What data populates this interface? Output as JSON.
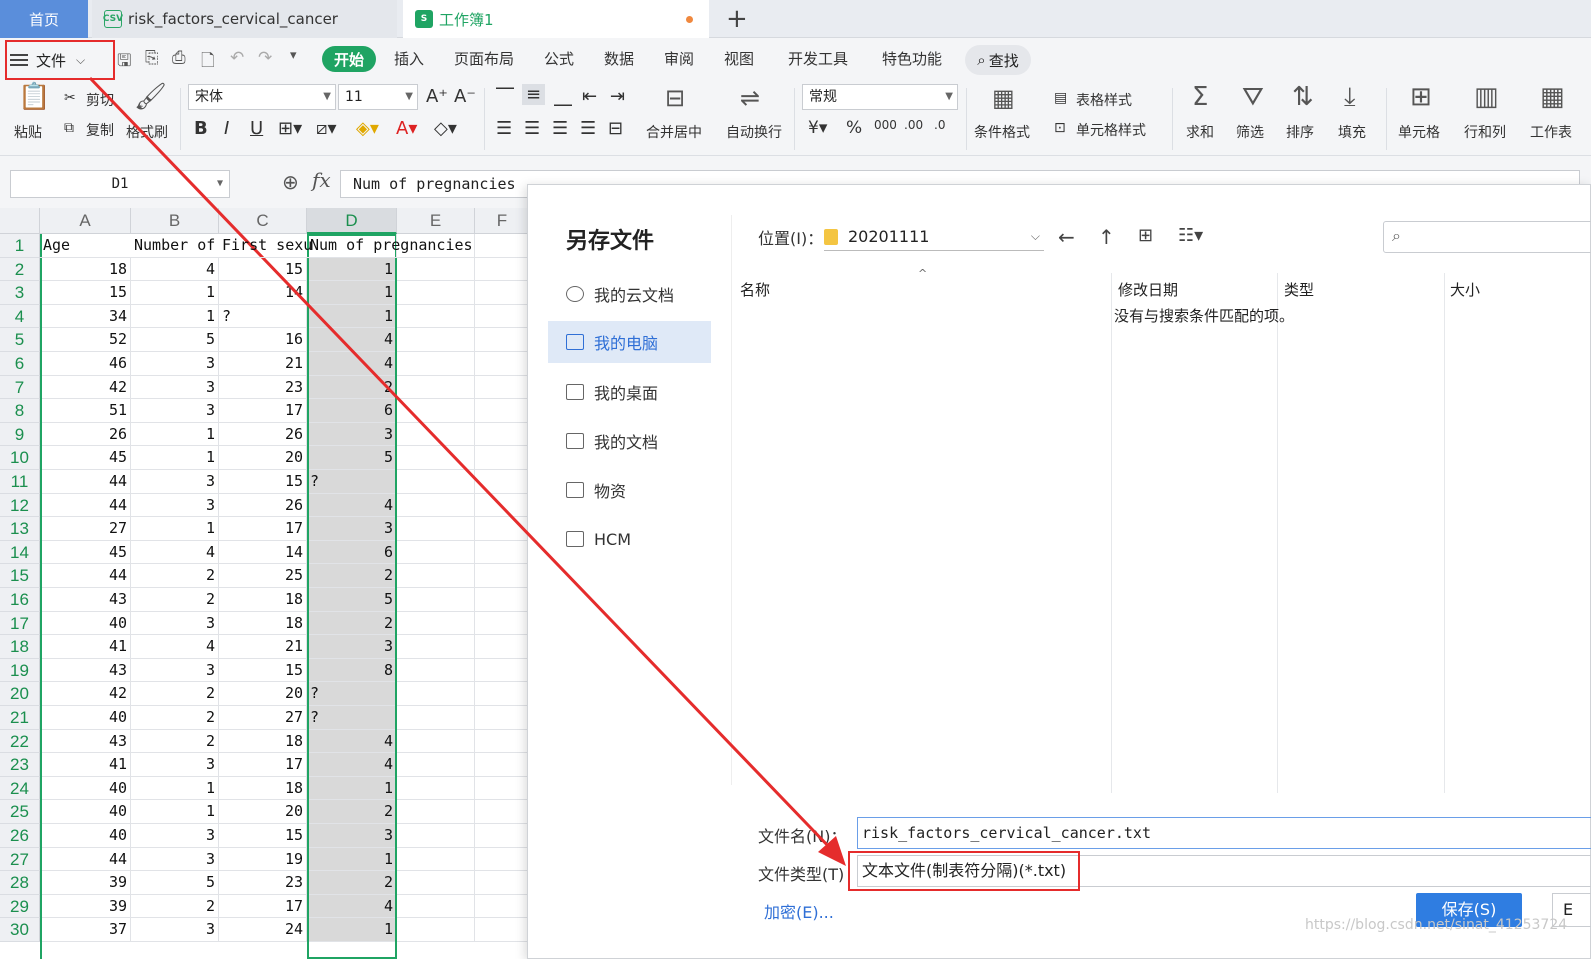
{
  "tabs": {
    "home": "首页",
    "csv_file": "risk_factors_cervical_cancer",
    "workbook": "工作簿1",
    "new_tab": "+"
  },
  "menu": {
    "file": "文件",
    "items": [
      "开始",
      "插入",
      "页面布局",
      "公式",
      "数据",
      "审阅",
      "视图",
      "开发工具",
      "特色功能"
    ],
    "search": "查找"
  },
  "ribbon": {
    "paste": "粘贴",
    "cut": "剪切",
    "copy": "复制",
    "format_painter": "格式刷",
    "font_name": "宋体",
    "font_size": "11",
    "merge_center": "合并居中",
    "wrap_text": "自动换行",
    "number_format": "常规",
    "conditional_format": "条件格式",
    "table_style": "表格样式",
    "cell_style": "单元格样式",
    "sum": "求和",
    "filter": "筛选",
    "sort": "排序",
    "fill": "填充",
    "cell": "单元格",
    "row_col": "行和列",
    "worksheet": "工作表"
  },
  "formula_bar": {
    "name_box": "D1",
    "fx": "fx",
    "content": "Num of pregnancies"
  },
  "sheet": {
    "columns": [
      "A",
      "B",
      "C",
      "D",
      "E",
      "F"
    ],
    "header_row": [
      "Age",
      "Number of",
      "First sexu",
      "Num of pregnancies",
      "",
      ""
    ],
    "rows": [
      [
        "18",
        "4",
        "15",
        "1"
      ],
      [
        "15",
        "1",
        "14",
        "1"
      ],
      [
        "34",
        "1",
        "?",
        "1"
      ],
      [
        "52",
        "5",
        "16",
        "4"
      ],
      [
        "46",
        "3",
        "21",
        "4"
      ],
      [
        "42",
        "3",
        "23",
        "2"
      ],
      [
        "51",
        "3",
        "17",
        "6"
      ],
      [
        "26",
        "1",
        "26",
        "3"
      ],
      [
        "45",
        "1",
        "20",
        "5"
      ],
      [
        "44",
        "3",
        "15",
        "?"
      ],
      [
        "44",
        "3",
        "26",
        "4"
      ],
      [
        "27",
        "1",
        "17",
        "3"
      ],
      [
        "45",
        "4",
        "14",
        "6"
      ],
      [
        "44",
        "2",
        "25",
        "2"
      ],
      [
        "43",
        "2",
        "18",
        "5"
      ],
      [
        "40",
        "3",
        "18",
        "2"
      ],
      [
        "41",
        "4",
        "21",
        "3"
      ],
      [
        "43",
        "3",
        "15",
        "8"
      ],
      [
        "42",
        "2",
        "20",
        "?"
      ],
      [
        "40",
        "2",
        "27",
        "?"
      ],
      [
        "43",
        "2",
        "18",
        "4"
      ],
      [
        "41",
        "3",
        "17",
        "4"
      ],
      [
        "40",
        "1",
        "18",
        "1"
      ],
      [
        "40",
        "1",
        "20",
        "2"
      ],
      [
        "40",
        "3",
        "15",
        "3"
      ],
      [
        "44",
        "3",
        "19",
        "1"
      ],
      [
        "39",
        "5",
        "23",
        "2"
      ],
      [
        "39",
        "2",
        "17",
        "4"
      ],
      [
        "37",
        "3",
        "24",
        "1"
      ]
    ],
    "row_numbers": [
      "1",
      "2",
      "3",
      "4",
      "5",
      "6",
      "7",
      "8",
      "9",
      "10",
      "11",
      "12",
      "13",
      "14",
      "15",
      "16",
      "17",
      "18",
      "19",
      "20",
      "21",
      "22",
      "23",
      "24",
      "25",
      "26",
      "27",
      "28",
      "29",
      "30"
    ]
  },
  "dialog": {
    "title": "另存文件",
    "sidebar": [
      "我的云文档",
      "我的电脑",
      "我的桌面",
      "我的文档",
      "物资",
      "HCM"
    ],
    "location_label": "位置(I)：",
    "location_value": "20201111",
    "columns": [
      "名称",
      "修改日期",
      "类型",
      "大小"
    ],
    "empty_message": "没有与搜索条件匹配的项。",
    "filename_label": "文件名(N)：",
    "filename_value": "risk_factors_cervical_cancer.txt",
    "filetype_label": "文件类型(T)",
    "filetype_value": "文本文件(制表符分隔)(*.txt)",
    "encrypt": "加密(E)...",
    "save": "保存(S)",
    "cancel": "E"
  },
  "watermark": "https://blog.csdn.net/sinat_41253724",
  "colors": {
    "accent_green": "#1fa463",
    "annotation_red": "#e52c2c",
    "primary_blue": "#2f7de1"
  }
}
